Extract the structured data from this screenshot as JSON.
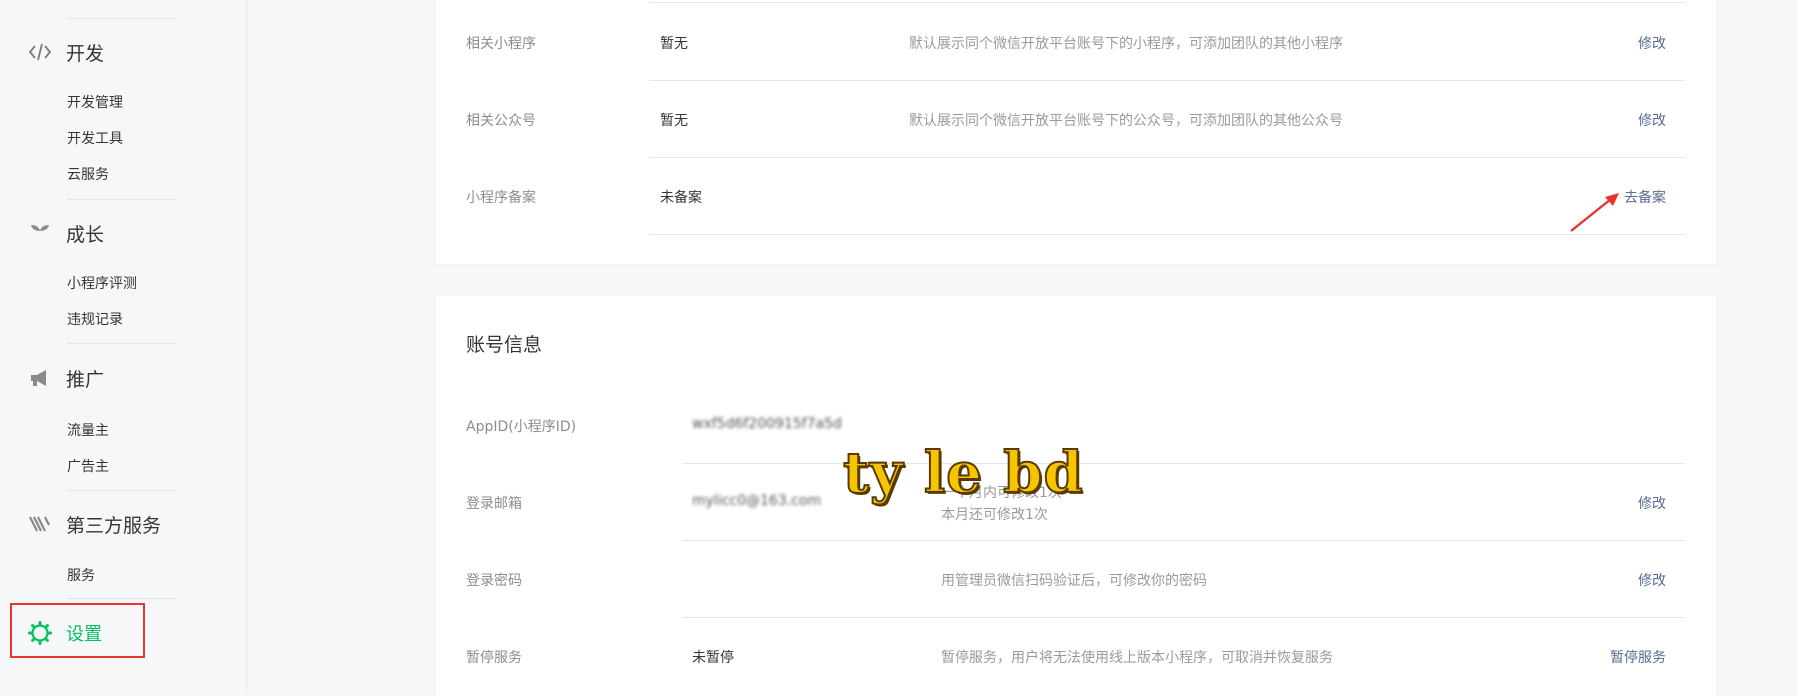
{
  "sidebar": {
    "groups": [
      {
        "name": "develop",
        "label": "开发",
        "icon": "code-icon",
        "items": [
          "开发管理",
          "开发工具",
          "云服务"
        ]
      },
      {
        "name": "growth",
        "label": "成长",
        "icon": "sprout-icon",
        "items": [
          "小程序评测",
          "违规记录"
        ]
      },
      {
        "name": "promote",
        "label": "推广",
        "icon": "megaphone-icon",
        "items": [
          "流量主",
          "广告主"
        ]
      },
      {
        "name": "third-party",
        "label": "第三方服务",
        "icon": "third-party-logo-icon",
        "items": [
          "服务"
        ]
      }
    ],
    "settings": {
      "label": "设置",
      "icon": "gear-icon",
      "active_color": "#07c160"
    }
  },
  "related": {
    "rows": [
      {
        "label": "相关小程序",
        "value": "暂无",
        "desc": "默认展示同个微信开放平台账号下的小程序，可添加团队的其他小程序",
        "action": "修改"
      },
      {
        "label": "相关公众号",
        "value": "暂无",
        "desc": "默认展示同个微信开放平台账号下的公众号，可添加团队的其他公众号",
        "action": "修改"
      },
      {
        "label": "小程序备案",
        "value": "未备案",
        "desc": "",
        "action": "去备案"
      }
    ]
  },
  "account": {
    "title": "账号信息",
    "appid": {
      "label": "AppID(小程序ID)",
      "value": "wxf5d6f200915f7a5d"
    },
    "email": {
      "label": "登录邮箱",
      "value": "mylicc0@163.com",
      "desc_line1": "一个月内可修改1次",
      "desc_line2": "本月还可修改1次",
      "action": "修改"
    },
    "password": {
      "label": "登录密码",
      "desc": "用管理员微信扫码验证后，可修改你的密码",
      "action": "修改"
    },
    "suspend": {
      "label": "暂停服务",
      "value": "未暂停",
      "desc": "暂停服务，用户将无法使用线上版本小程序，可取消并恢复服务",
      "action": "暂停服务"
    }
  },
  "watermark": "ty le bd",
  "colors": {
    "link": "#576b95",
    "accent": "#07c160",
    "highlight_box": "#e8332f",
    "arrow": "#e8332f"
  }
}
